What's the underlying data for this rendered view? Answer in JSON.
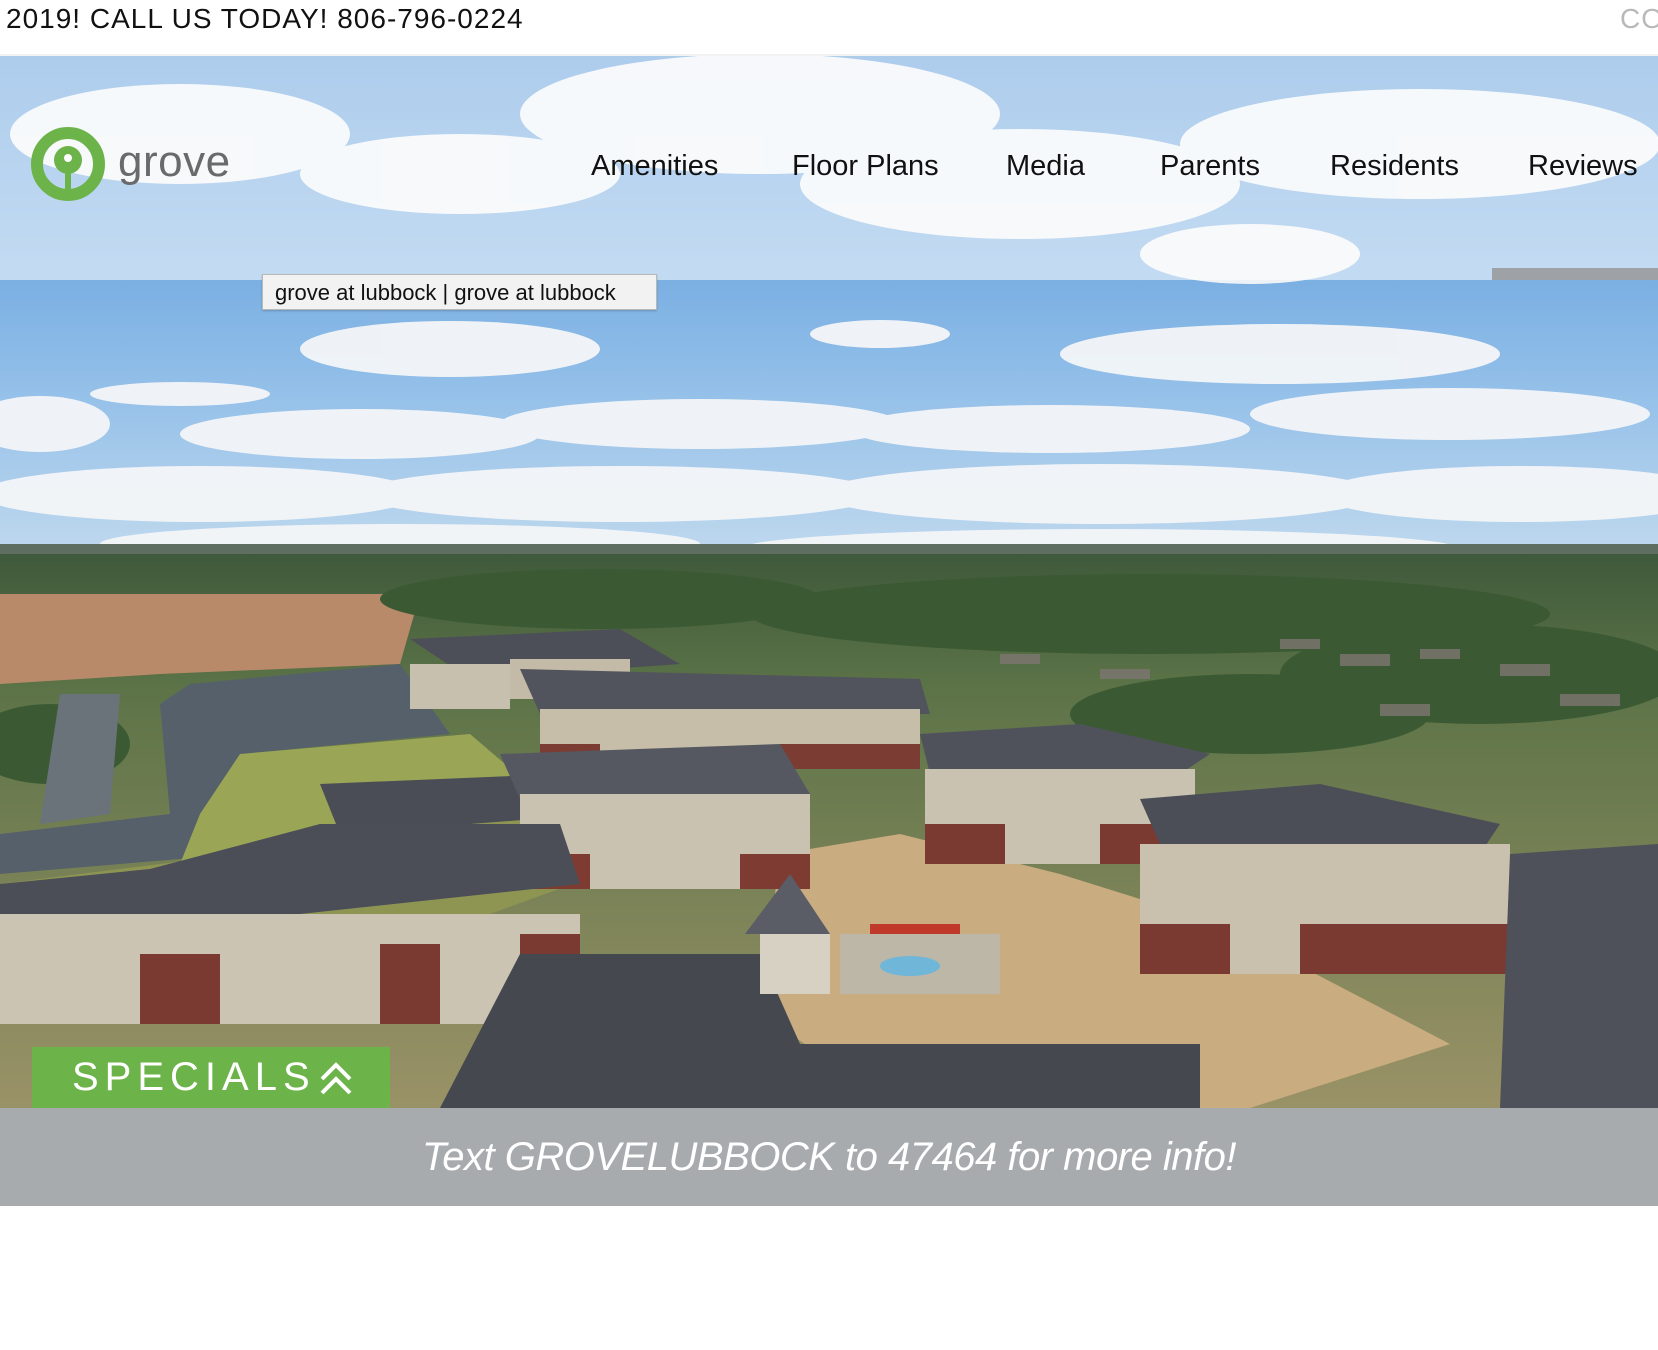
{
  "ticker": {
    "text": "2019! CALL US TODAY! 806-796-0224",
    "right_fragment": "CO"
  },
  "logo": {
    "wordmark": "grove",
    "brand_color": "#6cb34a"
  },
  "nav": {
    "items": [
      {
        "label": "Amenities"
      },
      {
        "label": "Floor Plans"
      },
      {
        "label": "Media"
      },
      {
        "label": "Parents"
      },
      {
        "label": "Residents"
      },
      {
        "label": "Reviews"
      }
    ]
  },
  "tooltip": {
    "text": "grove at lubbock | grove at lubbock"
  },
  "specials": {
    "label": "SPECIALS",
    "icon": "double-chevron-up-icon",
    "color": "#6cb34a"
  },
  "infobar": {
    "text": "Text GROVELUBBOCK to 47464 for more info!",
    "color": "#a7abae"
  }
}
